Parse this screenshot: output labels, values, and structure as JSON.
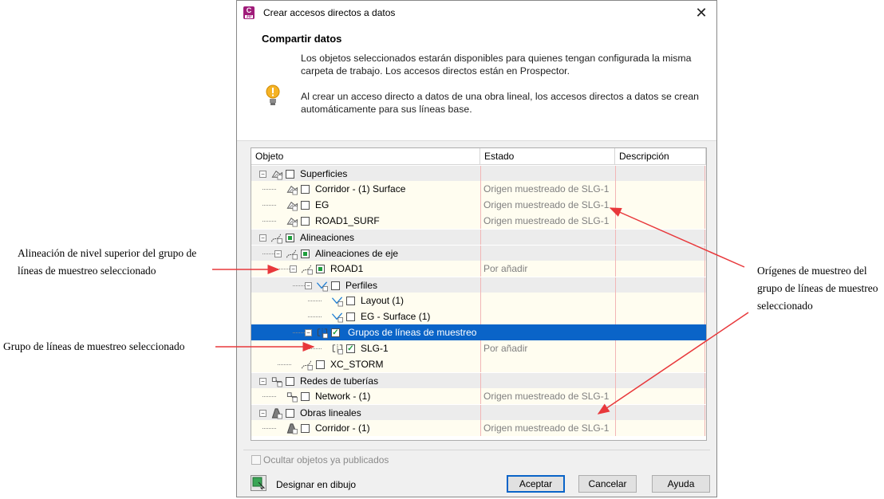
{
  "dialog": {
    "title": "Crear accesos directos a datos",
    "app_icon_letter": "C",
    "app_icon_sub": "3D",
    "close_label": "✕"
  },
  "header": {
    "title": "Compartir datos",
    "description": "Los objetos seleccionados estarán disponibles para quienes tengan configurada la misma carpeta de trabajo. Los accesos directos están en Prospector.",
    "note": "Al crear un acceso directo a datos de una obra lineal, los accesos directos a datos se crean automáticamente para sus líneas base."
  },
  "grid": {
    "columns": [
      "Objeto",
      "Estado",
      "Descripción"
    ],
    "rows": [
      {
        "label": "Superficies",
        "status": "",
        "kind": "category",
        "check": "empty",
        "icon": "surface-icon"
      },
      {
        "label": "Corridor - (1) Surface",
        "status": "Origen muestreado de SLG-1",
        "kind": "child",
        "check": "empty",
        "icon": "surface-icon"
      },
      {
        "label": "EG",
        "status": "Origen muestreado de SLG-1",
        "kind": "child",
        "check": "empty",
        "icon": "surface-icon"
      },
      {
        "label": "ROAD1_SURF",
        "status": "Origen muestreado de SLG-1",
        "kind": "child",
        "check": "empty",
        "icon": "surface-icon"
      },
      {
        "label": "Alineaciones",
        "status": "",
        "kind": "category",
        "check": "partial",
        "icon": "alignment-icon"
      },
      {
        "label": "Alineaciones de eje",
        "status": "",
        "kind": "category",
        "check": "partial",
        "icon": "alignment-icon"
      },
      {
        "label": "ROAD1",
        "status": "Por añadir",
        "kind": "child",
        "check": "partial",
        "icon": "alignment-icon"
      },
      {
        "label": "Perfiles",
        "status": "",
        "kind": "category",
        "check": "empty",
        "icon": "profile-icon"
      },
      {
        "label": "Layout (1)",
        "status": "",
        "kind": "child",
        "check": "empty",
        "icon": "profile-icon"
      },
      {
        "label": "EG - Surface (1)",
        "status": "",
        "kind": "child",
        "check": "empty",
        "icon": "profile-icon"
      },
      {
        "label": "Grupos de líneas de muestreo",
        "status": "",
        "kind": "selected",
        "check": "checked",
        "icon": "sample-line-group-icon"
      },
      {
        "label": "SLG-1",
        "status": "Por añadir",
        "kind": "child",
        "check": "checked",
        "icon": "sample-line-group-icon"
      },
      {
        "label": "XC_STORM",
        "status": "",
        "kind": "child",
        "check": "empty",
        "icon": "alignment-icon"
      },
      {
        "label": "Redes de tuberías",
        "status": "",
        "kind": "category",
        "check": "empty",
        "icon": "pipe-network-icon"
      },
      {
        "label": "Network - (1)",
        "status": "Origen muestreado de SLG-1",
        "kind": "child",
        "check": "empty",
        "icon": "pipe-network-icon"
      },
      {
        "label": "Obras lineales",
        "status": "",
        "kind": "category",
        "check": "empty",
        "icon": "corridor-icon"
      },
      {
        "label": "Corridor - (1)",
        "status": "Origen muestreado de SLG-1",
        "kind": "child",
        "check": "empty",
        "icon": "corridor-icon"
      }
    ]
  },
  "footer": {
    "hide_published": "Ocultar objetos ya publicados",
    "pick_in_drawing": "Designar en dibujo",
    "ok": "Aceptar",
    "cancel": "Cancelar",
    "help": "Ayuda"
  },
  "annotations": {
    "top_level_alignment": "Alineación de nivel superior del grupo de líneas de muestreo seleccionado",
    "selected_group": "Grupo de líneas de muestreo seleccionado",
    "sampled_sources": "Orígenes de muestreo del grupo de líneas de muestreo seleccionado"
  },
  "colors": {
    "selection": "#0a64c8",
    "category_bg": "#ececec",
    "child_bg": "#fffdf0",
    "check_green": "#1e9e3c",
    "arrow_red": "#e8383b"
  }
}
